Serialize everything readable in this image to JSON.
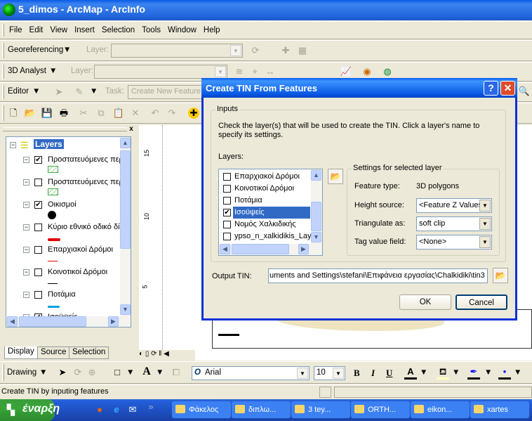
{
  "window": {
    "title": "5_dimos - ArcMap - ArcInfo"
  },
  "menu": [
    "File",
    "Edit",
    "View",
    "Insert",
    "Selection",
    "Tools",
    "Window",
    "Help"
  ],
  "toolbars": {
    "georef": {
      "label": "Georeferencing",
      "layer_label": "Layer:"
    },
    "analyst": {
      "label": "3D Analyst",
      "layer_label": "Layer:"
    },
    "editor": {
      "label": "Editor",
      "task_label": "Task:",
      "task_value": "Create New Feature"
    },
    "drawing": {
      "label": "Drawing",
      "font": "Arial",
      "size": "10",
      "bold": "B",
      "italic": "I",
      "underline": "U",
      "text_icon": "A"
    }
  },
  "toc": {
    "root": "Layers",
    "layers": [
      {
        "name": "Προστατευόμενες περ",
        "checked": true,
        "symbol": "hatch-green"
      },
      {
        "name": "Προστατευόμενες περ",
        "checked": false,
        "symbol": "hatch-green"
      },
      {
        "name": "Οικισμοί",
        "checked": true,
        "symbol": "black-dot"
      },
      {
        "name": "Κύριο εθνικό οδικό δί",
        "checked": false,
        "symbol": "thick-red-line"
      },
      {
        "name": "Επαρχιακοί Δρόμοι",
        "checked": false,
        "symbol": "thin-red-line"
      },
      {
        "name": "Κοινοτικοί Δρόμοι",
        "checked": false,
        "symbol": "black-line"
      },
      {
        "name": "Ποτάμια",
        "checked": false,
        "symbol": "blue-line"
      },
      {
        "name": "Ισοϋψείς",
        "checked": true,
        "symbol": "beige-fill"
      }
    ],
    "tabs": [
      "Display",
      "Source",
      "Selection"
    ]
  },
  "map": {
    "ruler_labels": [
      "15",
      "10",
      "5"
    ]
  },
  "dialog": {
    "title": "Create TIN From Features",
    "help": "?",
    "close": "✕",
    "inputs_label": "Inputs",
    "instructions": "Check the layer(s) that will be used to create the TIN.  Click a layer's name to specify its settings.",
    "layers_label": "Layers:",
    "layers": [
      {
        "name": "Επαρχιακοί Δρόμοι",
        "checked": false
      },
      {
        "name": "Κοινοτικοί Δρόμοι",
        "checked": false
      },
      {
        "name": "Ποτάμια",
        "checked": false
      },
      {
        "name": "Ισοϋψείς",
        "checked": true,
        "selected": true
      },
      {
        "name": "Νομός Χαλκιδικής",
        "checked": false
      },
      {
        "name": "ypso_n_xalkidikis_Laye",
        "checked": false
      }
    ],
    "settings_label": "Settings for selected layer",
    "feature_type_label": "Feature type:",
    "feature_type": "3D polygons",
    "height_source_label": "Height source:",
    "height_source": "<Feature Z Values>",
    "triangulate_label": "Triangulate as:",
    "triangulate": "soft clip",
    "tag_label": "Tag value field:",
    "tag": "<None>",
    "output_label": "Output TIN:",
    "output_value": "uments and Settings\\stefani\\Επιφάνεια εργασίας\\Chalkidiki\\tin3",
    "ok": "OK",
    "cancel": "Cancel"
  },
  "status": "Create TIN by inputing features",
  "taskbar": {
    "start": "έναρξη",
    "tasks": [
      "Φάκελος",
      "διπλω...",
      "3 tey...",
      "ORTH...",
      "eikon...",
      "xartes"
    ]
  },
  "colors": {
    "titlebar": "#0a5ce8",
    "selection": "#316ac5",
    "accent_red": "#e00000",
    "river_blue": "#00a0e0"
  }
}
